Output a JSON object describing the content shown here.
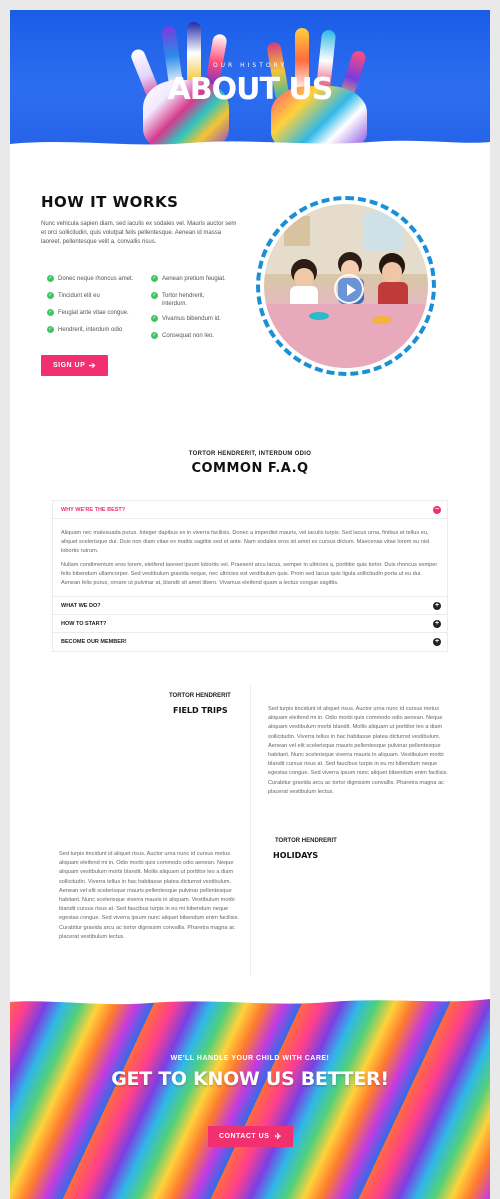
{
  "hero": {
    "subtitle": "OUR HISTORY",
    "title": "ABOUT US"
  },
  "how_it_works": {
    "title": "HOW IT WORKS",
    "text": "Nunc vehicula sapien diam, sed iaculis ex sodales vel. Mauris auctor sem et orci sollicitudin, quis volutpat felis pellentesque. Aenean id massa laoreet, pellentesque velit a, convallis risus.",
    "checks_left": [
      "Donec neque rhoncus amet.",
      "Tincidunt elit eu",
      "Feugiat ante vitae congue.",
      "Hendrerit, interdum odio"
    ],
    "checks_right": [
      "Aenean pretium feugiat.",
      "Tortor hendrerit, interdum.",
      "Vivamus bibendum id.",
      "Consequat non leo."
    ],
    "signup_label": "SIGN UP",
    "check_icon": "check-circle-icon",
    "video_icon": "play-icon"
  },
  "faq": {
    "kicker": "TORTOR HENDRERIT, INTERDUM ODIO",
    "title": "COMMON F.A.Q",
    "items": [
      {
        "question": "WHY WE'RE THE BEST?",
        "toggle": "−",
        "answer_p1": "Aliquam nec malesuada purus. Integer dapibus ex in viverra facilisis. Donec a imperdiet mauris, vel iaculis turpis. Sed lacus urna, finibus et tellus eu, aliquet scelerisque dui. Duis non diam vitae ex mattis sagittis sed et ante. Nam sodales eros sit amet ex cursus dictum. Maecenas vitae lorem eu nisl lobortis rutrum.",
        "answer_p2": "Nullam condimentum eros lorem, eleifend laoreet ipsum lobortis vel. Praesent arcu lacus, semper in ultricies a, porttitor quis tortor. Duis rhoncus semper felis bibendum ullamcorper. Sed vestibulum gravida neque, nec ultricies est vestibulum quis. Proin sed lacus quis ligula sollicitudin porta ut eu dui. Aenean felis purus, ornare ut pulvinar at, blandit sit amet libero. Vivamus eleifend quam a lectus congue sagittis."
      },
      {
        "question": "WHAT WE DO?",
        "toggle": "+"
      },
      {
        "question": "HOW TO START?",
        "toggle": "+"
      },
      {
        "question": "BECOME OUR MEMBER!",
        "toggle": "+"
      }
    ]
  },
  "field_trips": {
    "kicker": "TORTOR HENDRERIT",
    "title": "FIELD TRIPS",
    "text": "Sed turpis tincidunt id aliquet risus. Auctor urna nunc id cursus metus aliquam eleifend mi in. Odio morbi quis commodo odio aenean. Neque aliquam vestibulum morbi blandit. Mollis aliquam ut porttitor leo a diam sollicitudin. Viverra tellus in hac habitasse platea dictumst vestibulum. Aenean vel elit scelerisque mauris pellentesque pulvinar pellentesque habitant. Nunc scelerisque viverra mauris in aliquam. Vestibulum morbi blandit cursus risus at. Sed faucibus turpis in eu mi bibendum neque egestas congue. Sed viverra ipsum nunc aliquet bibendum enim facilisis. Curabitur gravida arcu ac tortor dignissim convallis. Pharetra magna ac placerat vestibulum lectus."
  },
  "holidays": {
    "kicker": "TORTOR HENDRERIT",
    "title": "HOLIDAYS",
    "text": "Sed turpis tincidunt id aliquet risus. Auctor urna nunc id cursus metus aliquam eleifend mi in. Odio morbi quis commodo odio aenean. Neque aliquam vestibulum morbi blandit. Mollis aliquam ut porttitor leo a diam sollicitudin. Viverra tellus in hac habitasse platea dictumst vestibulum. Aenean vel elit scelerisque mauris pellentesque pulvinar pellentesque habitant. Nunc scelerisque viverra mauris in aliquam. Vestibulum morbi blandit cursus risus at. Sed faucibus turpis in eu mi bibendum neque egestas congue. Sed viverra ipsum nunc aliquet bibendum enim facilisis. Curabitur gravida arcu ac tortor dignissim convallis. Pharetra magna ac placerat vestibulum lectus."
  },
  "cta": {
    "kicker": "WE'LL HANDLE YOUR CHILD WITH CARE!",
    "title": "GET TO KNOW US BETTER!",
    "button_label": "CONTACT US",
    "button_icon": "paper-plane-icon"
  },
  "colors": {
    "accent": "#f0306f",
    "hero_blue": "#2563e8",
    "check_green": "#43c463",
    "ring_blue": "#1a8fd6"
  }
}
